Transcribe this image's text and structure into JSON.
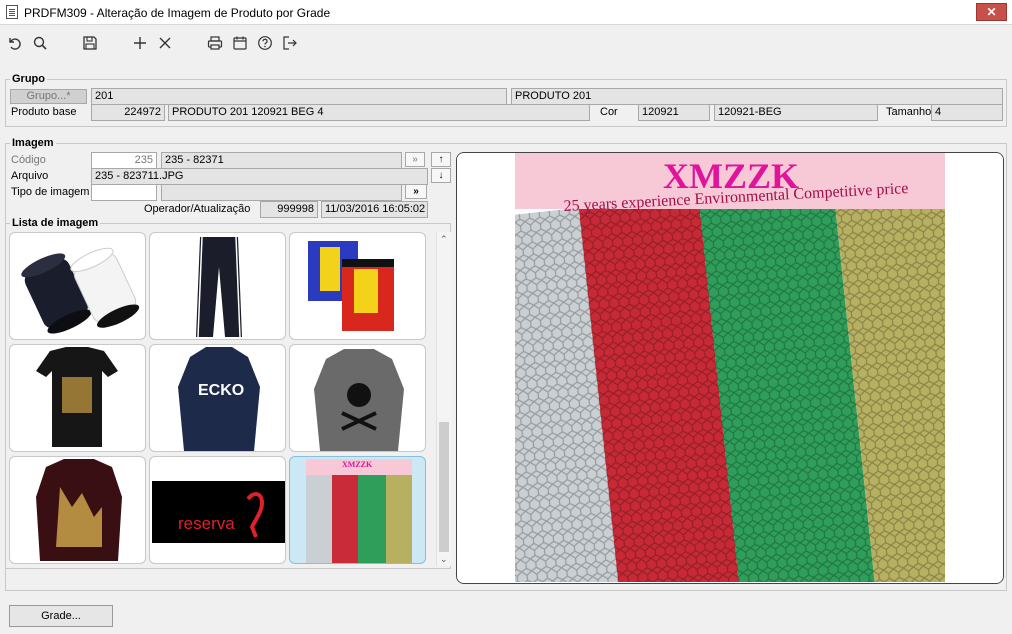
{
  "window": {
    "title": "PRDFM309 - Alteração de Imagem de Produto por Grade",
    "close_label": "✕"
  },
  "toolbar": {
    "icons": [
      "undo-icon",
      "search-icon",
      "save-icon",
      "add-icon",
      "delete-icon",
      "print-icon",
      "calendar-icon",
      "help-icon",
      "exit-icon"
    ]
  },
  "grupo": {
    "legend": "Grupo",
    "grupo_button": "Grupo...*",
    "grupo_code": "201",
    "grupo_name": "PRODUTO 201",
    "produto_base_label": "Produto base",
    "produto_base_code": "224972",
    "produto_base_name": "PRODUTO 201 120921 BEG 4",
    "cor_label": "Cor",
    "cor_code": "120921",
    "cor_name": "120921-BEG",
    "tamanho_label": "Tamanho",
    "tamanho_value": "4"
  },
  "imagem": {
    "legend": "Imagem",
    "codigo_label": "Código",
    "codigo_value": "235",
    "codigo_desc": "235 - 82371",
    "arquivo_label": "Arquivo",
    "arquivo_value": "235 - 823711.JPG",
    "tipo_label": "Tipo de imagem",
    "tipo_value": "",
    "tipo_button": "»",
    "operador_label": "Operador/Atualização",
    "operador_value": "999998",
    "atualizacao_value": "11/03/2016 16:05:02"
  },
  "lista": {
    "legend": "Lista de imagem",
    "items": [
      {
        "name": "thread-spools"
      },
      {
        "name": "track-pants"
      },
      {
        "name": "racing-shorts"
      },
      {
        "name": "black-tshirt"
      },
      {
        "name": "ecko-hoodie"
      },
      {
        "name": "skull-sweatshirt"
      },
      {
        "name": "printed-hoodie"
      },
      {
        "name": "reserva-logo",
        "text": "reserva"
      },
      {
        "name": "xmzzk-mesh",
        "selected": true
      }
    ]
  },
  "preview": {
    "brand": "XMZZK",
    "tagline": "25 years experience  Environmental  Competitive price",
    "colors": {
      "banner": "#f7c8d6",
      "brand": "#e0139a",
      "tagline": "#a0104a"
    }
  },
  "footer": {
    "grade_button": "Grade..."
  }
}
